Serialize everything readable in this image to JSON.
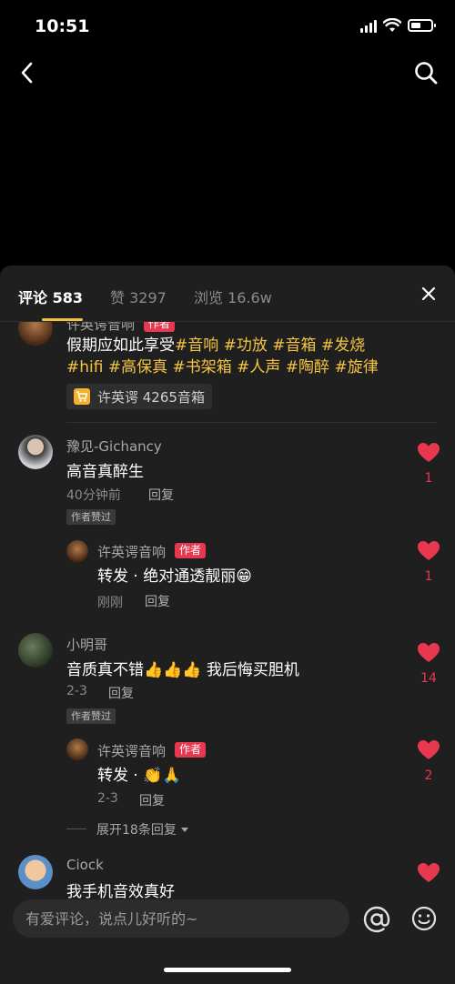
{
  "status_bar": {
    "time": "10:51"
  },
  "tabs": {
    "comments": "评论 583",
    "likes": "赞 3297",
    "views": "浏览 16.6w"
  },
  "post": {
    "author": "许英谔音响",
    "author_tag": "作者",
    "line1_plain": "假期应如此享受",
    "line1_tags": "#音响 #功放 #音箱 #发烧",
    "line2_tags": "#hifi #高保真 #书架箱 #人声 #陶醉 #旋律",
    "product": "许英谔 4265音箱"
  },
  "comments": [
    {
      "name": "豫见-Gichancy",
      "text": "高音真醉生",
      "time": "40分钟前",
      "reply_label": "回复",
      "liked_tag": "作者赞过",
      "likes": "1",
      "reply": {
        "name": "许英谔音响",
        "tag": "作者",
        "text": "转发 · 绝对通透靓丽😁",
        "time": "刚刚",
        "reply_label": "回复",
        "likes": "1"
      }
    },
    {
      "name": "小明哥",
      "text": "音质真不错👍👍👍 我后悔买胆机",
      "time": "2-3",
      "reply_label": "回复",
      "liked_tag": "作者赞过",
      "likes": "14",
      "reply": {
        "name": "许英谔音响",
        "tag": "作者",
        "text": "转发 · 👏🙏",
        "time": "2-3",
        "reply_label": "回复",
        "likes": "2"
      },
      "expand": "展开18条回复"
    },
    {
      "name": "Ciock",
      "text": "我手机音效真好"
    }
  ],
  "input": {
    "placeholder": "有爱评论，说点儿好听的~"
  },
  "colors": {
    "accent": "#f5c542",
    "like": "#e8384f",
    "panel": "#1f1f1f"
  },
  "icons": [
    "back-icon",
    "search-icon",
    "close-icon",
    "heart-icon",
    "cart-icon",
    "at-icon",
    "emoji-icon"
  ]
}
